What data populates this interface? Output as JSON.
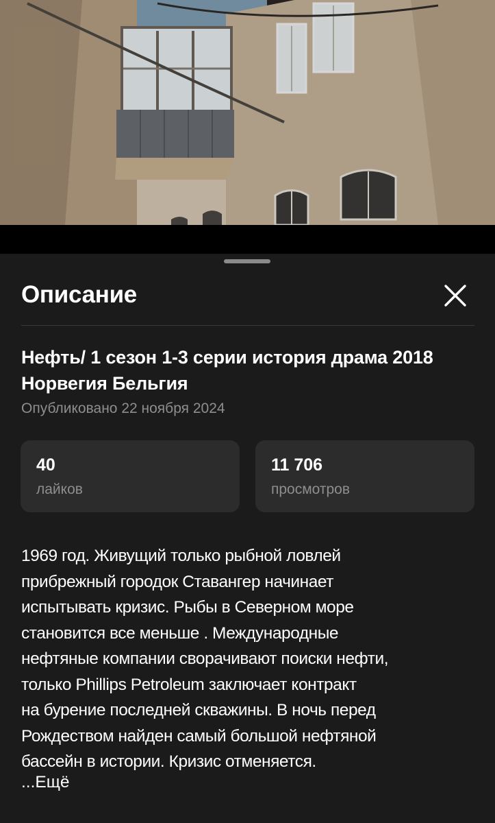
{
  "sheet": {
    "title": "Описание",
    "close_icon": "close-icon"
  },
  "video": {
    "title": "Нефть/ 1 сезон 1-3 серии история драма 2018 Норвегия Бельгия",
    "published": "Опубликовано 22 ноября 2024"
  },
  "stats": {
    "likes": {
      "value": "40",
      "label": "лайков"
    },
    "views": {
      "value": "11 706",
      "label": "просмотров"
    }
  },
  "description": {
    "lines": [
      "1969 год. Живущий только рыбной ловлей",
      "прибрежный городок Ставангер начинает",
      "испытывать кризис. Рыбы в Северном море",
      "становится все меньше . Международные",
      "нефтяные компании сворачивают поиски нефти,",
      "только Phillips Petroleum заключает контракт",
      "на бурение последней скважины. В ночь перед",
      "Рождеством найден самый большой нефтяной",
      "бассейн в истории. Кризис отменяется."
    ],
    "more_label": "...Ещё"
  },
  "colors": {
    "sheet_bg": "#1b1b1b",
    "card_bg": "#2c2c2c",
    "muted_text": "#8e8e8e",
    "primary_text": "#ffffff"
  }
}
